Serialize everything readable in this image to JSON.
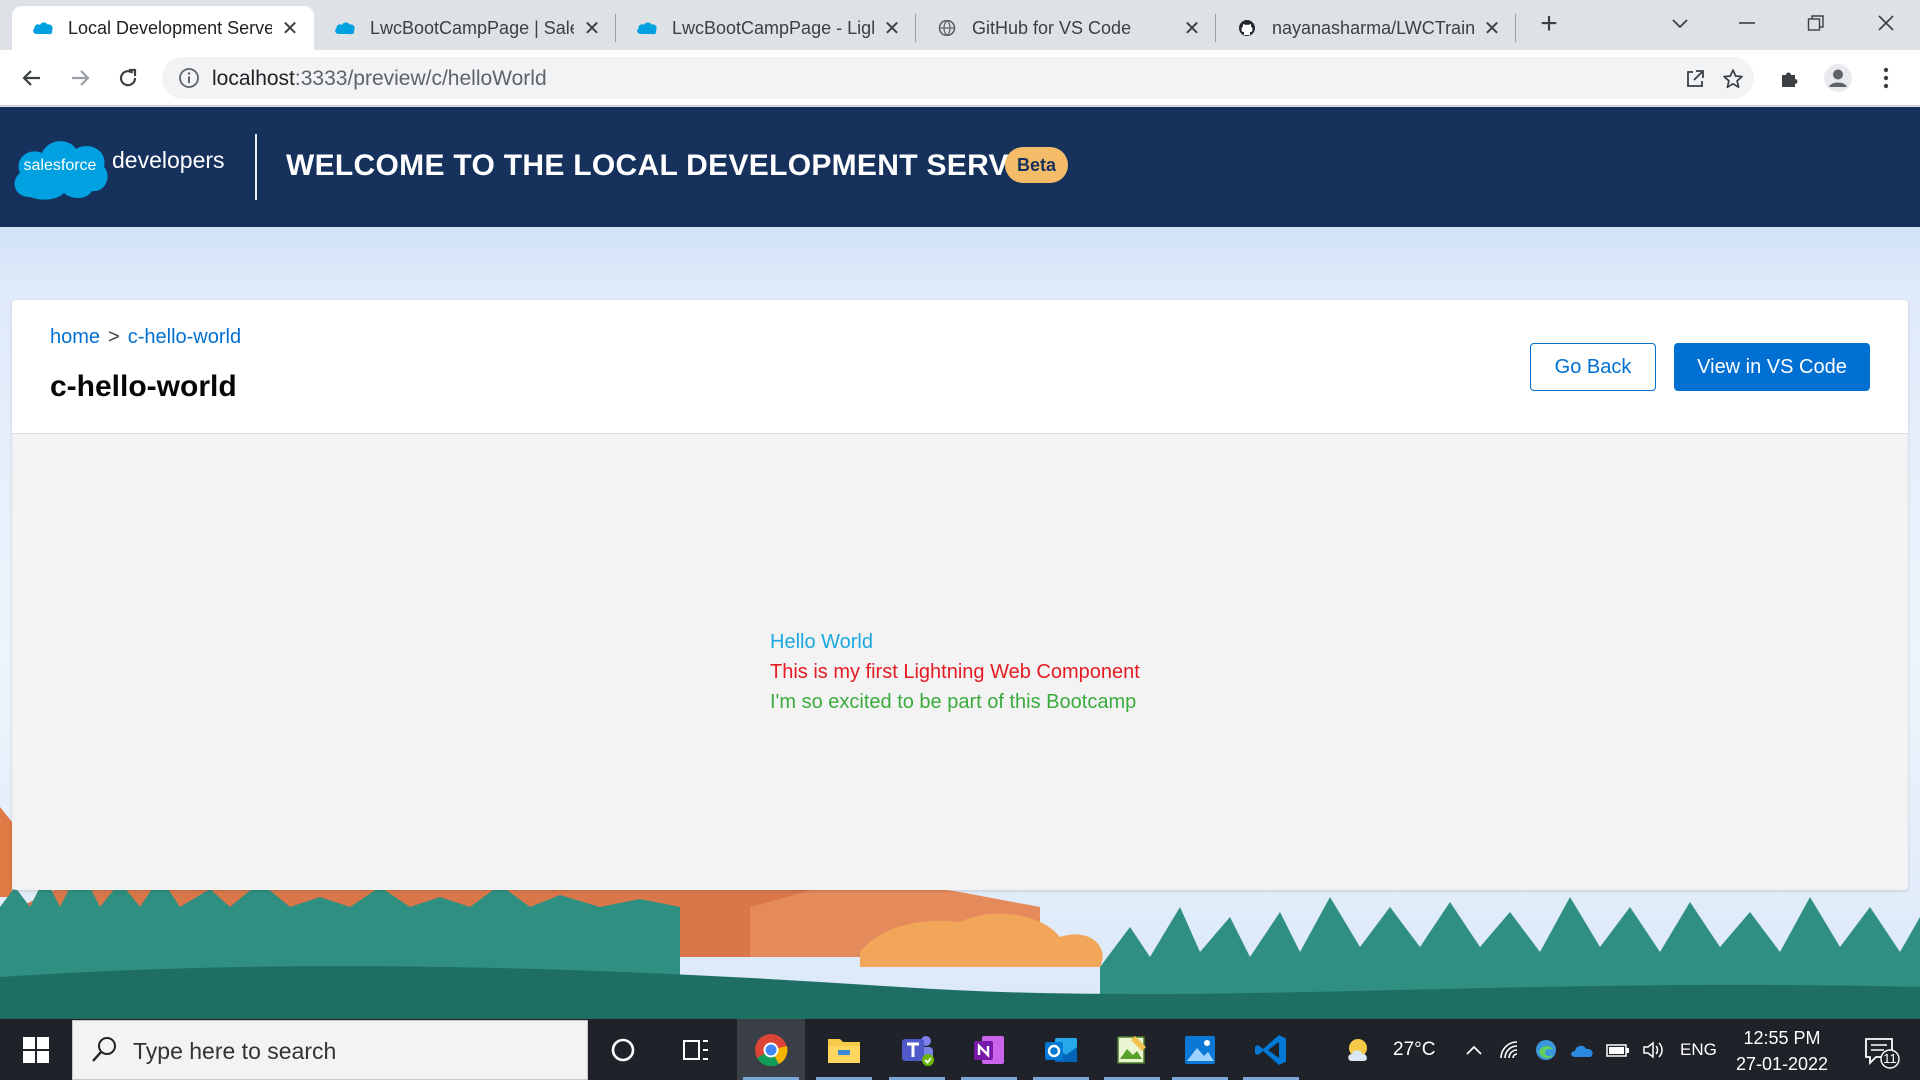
{
  "browser": {
    "tabs": [
      {
        "title": "Local Development Server",
        "favicon": "salesforce-cloud-icon",
        "active": true
      },
      {
        "title": "LwcBootCampPage | Salesforce",
        "favicon": "salesforce-cloud-icon",
        "active": false
      },
      {
        "title": "LwcBootCampPage - Lightning",
        "favicon": "salesforce-cloud-icon",
        "active": false
      },
      {
        "title": "GitHub for VS Code",
        "favicon": "globe-icon",
        "active": false
      },
      {
        "title": "nayanasharma/LWCTraining",
        "favicon": "github-icon",
        "active": false
      }
    ],
    "close_glyph": "✕",
    "new_tab_glyph": "+",
    "address": {
      "host": "localhost",
      "path": ":3333/preview/c/helloWorld"
    }
  },
  "header": {
    "logo_text": "salesforce",
    "developers": "developers",
    "title": "Welcome to the Local Development Server",
    "badge": "Beta",
    "background": "#16325c",
    "badge_color": "#f4bc68"
  },
  "component": {
    "breadcrumb": {
      "home": "home",
      "separator": ">",
      "current": "c-hello-world"
    },
    "title": "c-hello-world",
    "go_back": "Go Back",
    "view_in_vscode": "View in VS Code",
    "accent": "#0070d2"
  },
  "preview": {
    "line1": "Hello World",
    "line2": "This is my first Lightning Web Component",
    "line3": "I'm so excited to be part of this Bootcamp"
  },
  "taskbar": {
    "search_placeholder": "Type here to search",
    "weather": "27°C",
    "language": "ENG",
    "time": "12:55 PM",
    "date": "27-01-2022",
    "notifications": "11",
    "apps": [
      "cortana-icon",
      "task-view-icon",
      "chrome-icon",
      "file-explorer-icon",
      "teams-icon",
      "onenote-icon",
      "outlook-icon",
      "photos-editor-icon",
      "photos-icon",
      "vscode-icon"
    ]
  }
}
